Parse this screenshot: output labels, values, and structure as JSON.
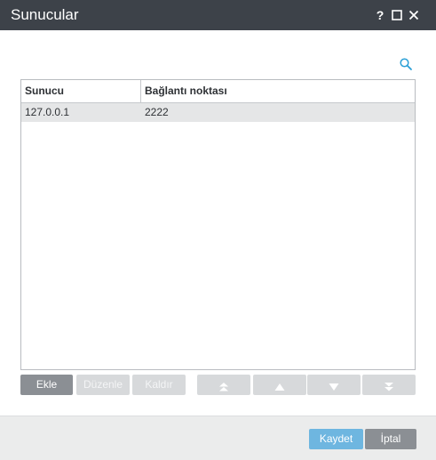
{
  "window": {
    "title": "Sunucular",
    "help_label": "?"
  },
  "table": {
    "columns": [
      "Sunucu",
      "Bağlantı noktası"
    ],
    "rows": [
      {
        "host": "127.0.0.1",
        "port": "2222"
      }
    ]
  },
  "toolbar": {
    "add_label": "Ekle",
    "edit_label": "Düzenle",
    "remove_label": "Kaldır"
  },
  "footer": {
    "save_label": "Kaydet",
    "cancel_label": "İptal"
  },
  "icons": {
    "search": "search-icon",
    "maximize": "maximize-icon",
    "close": "close-icon",
    "move_top": "double-chevron-up-icon",
    "move_up": "triangle-up-icon",
    "move_down": "triangle-down-icon",
    "move_bottom": "double-chevron-down-icon"
  },
  "colors": {
    "titlebar": "#3d4249",
    "primary_button": "#6eb6e0",
    "secondary_button": "#8b8f94",
    "disabled_button": "#d7d9db",
    "selected_row": "#e5e6e7",
    "accent_icon": "#2a9fd6"
  }
}
